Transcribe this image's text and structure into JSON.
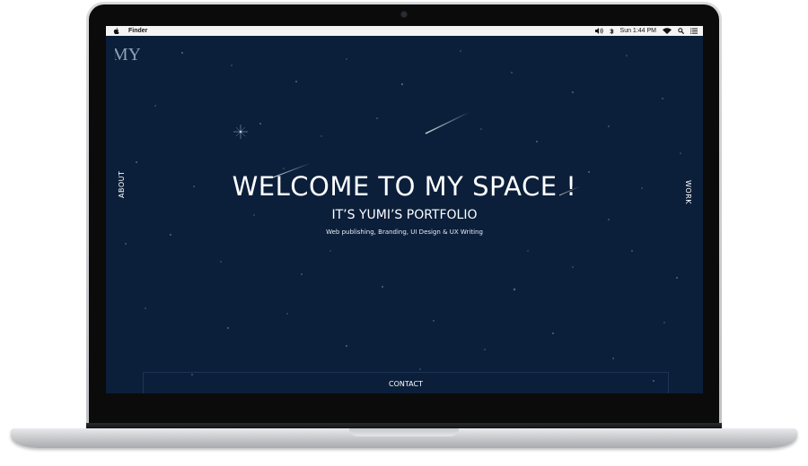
{
  "menubar": {
    "app_name": "Finder",
    "clock": "Sun 1:44 PM",
    "icons": [
      "apple-icon",
      "volume-icon",
      "bluetooth-icon",
      "wifi-icon",
      "search-icon",
      "list-icon"
    ]
  },
  "logo": {
    "letters": "MY"
  },
  "nav": {
    "about": "ABOUT",
    "work": "WORK",
    "contact": "CONTACT"
  },
  "hero": {
    "title": "WELCOME TO MY SPACE !",
    "subtitle": "IT’S YUMI’S PORTFOLIO",
    "tagline": "Web publishing, Branding, UI Design & UX Writing"
  },
  "colors": {
    "screen_background": "#0b1f3a",
    "text": "#ffffff",
    "logo": "#8fa0b6"
  }
}
